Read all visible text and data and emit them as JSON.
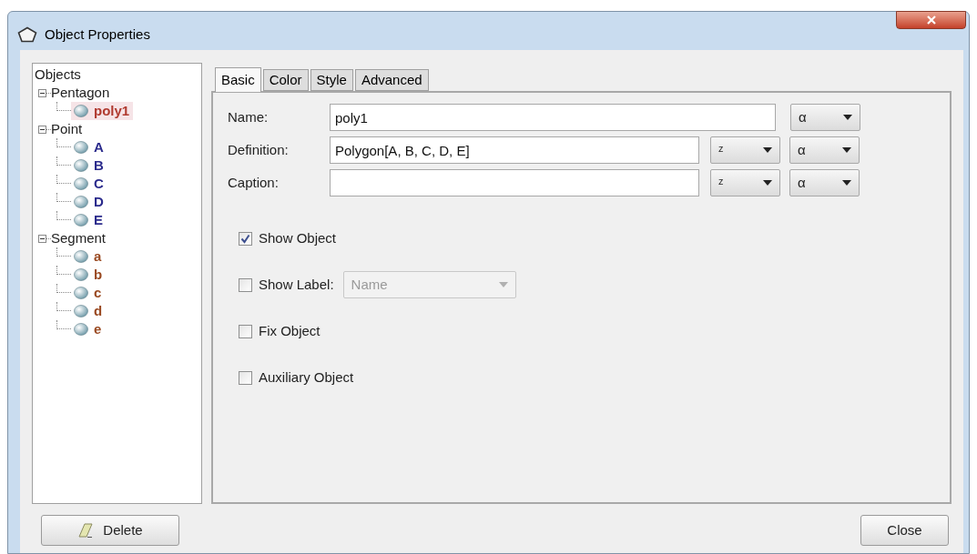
{
  "window": {
    "title": "Object Properties"
  },
  "tree": {
    "root": "Objects",
    "children": [
      {
        "label": "Pentagon",
        "expanded": true,
        "children": [
          {
            "label": "poly1",
            "color": "#b03a30",
            "selected": true
          }
        ]
      },
      {
        "label": "Point",
        "expanded": true,
        "children": [
          {
            "label": "A",
            "color": "#2b2b8c",
            "selected": false
          },
          {
            "label": "B",
            "color": "#2b2b8c",
            "selected": false
          },
          {
            "label": "C",
            "color": "#2b2b8c",
            "selected": false
          },
          {
            "label": "D",
            "color": "#2b2b8c",
            "selected": false
          },
          {
            "label": "E",
            "color": "#2b2b8c",
            "selected": false
          }
        ]
      },
      {
        "label": "Segment",
        "expanded": true,
        "children": [
          {
            "label": "a",
            "color": "#9a4a22",
            "selected": false
          },
          {
            "label": "b",
            "color": "#9a4a22",
            "selected": false
          },
          {
            "label": "c",
            "color": "#9a4a22",
            "selected": false
          },
          {
            "label": "d",
            "color": "#9a4a22",
            "selected": false
          },
          {
            "label": "e",
            "color": "#9a4a22",
            "selected": false
          }
        ]
      }
    ]
  },
  "tabs": [
    {
      "label": "Basic",
      "selected": true
    },
    {
      "label": "Color",
      "selected": false
    },
    {
      "label": "Style",
      "selected": false
    },
    {
      "label": "Advanced",
      "selected": false
    }
  ],
  "fields": [
    {
      "label": "Name:",
      "value": "poly1",
      "dropdowns": [
        "α"
      ]
    },
    {
      "label": "Definition:",
      "value": "Polygon[A, B, C, D, E]",
      "dropdowns": [
        "ᶻ",
        "α"
      ]
    },
    {
      "label": "Caption:",
      "dropdowns": [
        "ᶻ",
        "α"
      ]
    }
  ],
  "checkboxes": [
    {
      "label": "Show Object",
      "checked": true
    },
    {
      "label": "Show Label:",
      "checked": false,
      "dropdown": {
        "value": "Name",
        "disabled": true
      }
    },
    {
      "label": "Fix Object",
      "checked": false
    },
    {
      "label": "Auxiliary Object",
      "checked": false
    }
  ],
  "buttons": [
    {
      "kind": "delete",
      "label": "Delete"
    },
    {
      "kind": "close",
      "label": "Close"
    }
  ]
}
